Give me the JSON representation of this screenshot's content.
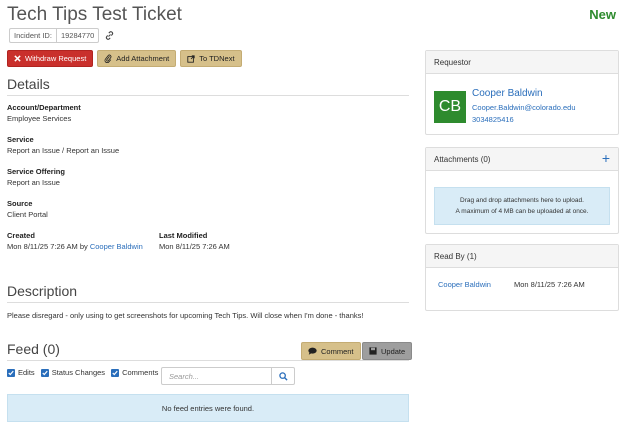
{
  "ticket": {
    "title": "Tech Tips Test Ticket",
    "status": "New",
    "incident_label": "Incident ID:",
    "incident_id": "19284770"
  },
  "toolbar": {
    "withdraw_label": "Withdraw Request",
    "attach_label": "Add Attachment",
    "tdnext_label": "To TDNext"
  },
  "details": {
    "heading": "Details",
    "account_label": "Account/Department",
    "account_value": "Employee Services",
    "service_label": "Service",
    "service_value": "Report an Issue / Report an Issue",
    "offering_label": "Service Offering",
    "offering_value": "Report an Issue",
    "source_label": "Source",
    "source_value": "Client Portal",
    "created_label": "Created",
    "created_value": "Mon 8/11/25 7:26 AM by",
    "created_by": "Cooper Baldwin",
    "modified_label": "Last Modified",
    "modified_value": "Mon 8/11/25 7:26 AM"
  },
  "description": {
    "heading": "Description",
    "text": "Please disregard - only using to get screenshots for upcoming Tech Tips. Will close when I'm done - thanks!"
  },
  "feed": {
    "heading": "Feed (0)",
    "comment_label": "Comment",
    "update_label": "Update",
    "filter_edits": "Edits",
    "filter_status": "Status Changes",
    "filter_comments": "Comments",
    "search_placeholder": "Search...",
    "empty_message": "No feed entries were found."
  },
  "requestor": {
    "heading": "Requestor",
    "initials": "CB",
    "name": "Cooper Baldwin",
    "email": "Cooper.Baldwin@colorado.edu",
    "phone": "3034825416"
  },
  "attachments": {
    "heading": "Attachments (0)",
    "drop_line1": "Drag and drop attachments here to upload.",
    "drop_line2": "A maximum of 4 MB can be uploaded at once."
  },
  "read_by": {
    "heading": "Read By (1)",
    "name": "Cooper Baldwin",
    "time": "Mon 8/11/25 7:26 AM"
  },
  "colors": {
    "accent": "#2a6ebb",
    "status_new": "#2e8b2e",
    "danger": "#c9302c",
    "tan": "#d6c08a",
    "avatar": "#2e8b2e"
  }
}
